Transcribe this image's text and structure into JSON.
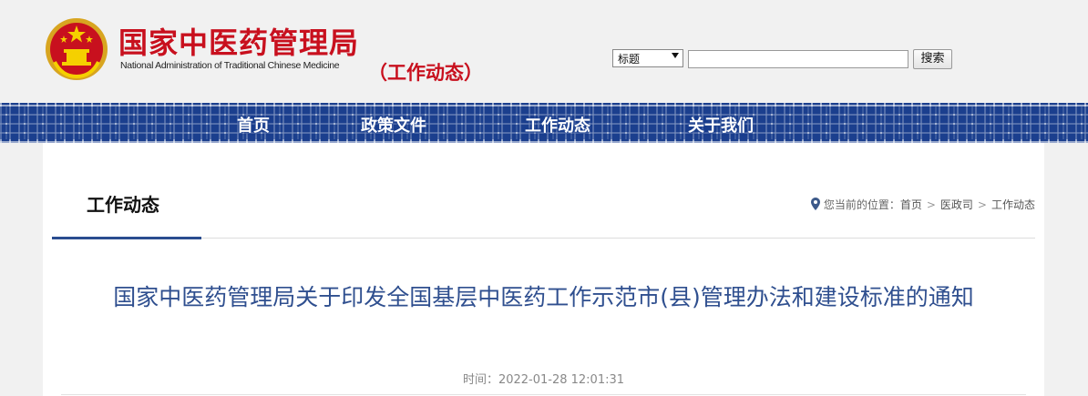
{
  "header": {
    "site_title": "国家中医药管理局",
    "site_subtitle": "National Administration of Traditional Chinese Medicine",
    "section_tag": "（工作动态）",
    "emblem_icon": "national-emblem-icon",
    "brand_color": "#c8101e"
  },
  "search": {
    "select_value": "标题",
    "input_value": "",
    "button_label": "搜索"
  },
  "nav": {
    "items": [
      {
        "label": "首页"
      },
      {
        "label": "政策文件"
      },
      {
        "label": "工作动态"
      },
      {
        "label": "关于我们"
      }
    ],
    "band_color": "#1b3f8e"
  },
  "panel": {
    "title": "工作动态",
    "breadcrumb": {
      "prefix": "您当前的位置：",
      "items": [
        "首页",
        "医政司",
        "工作动态"
      ],
      "separator": ">"
    }
  },
  "article": {
    "title": "国家中医药管理局关于印发全国基层中医药工作示范市(县)管理办法和建设标准的通知",
    "time": "时间：2022-01-28 12:01:31"
  }
}
